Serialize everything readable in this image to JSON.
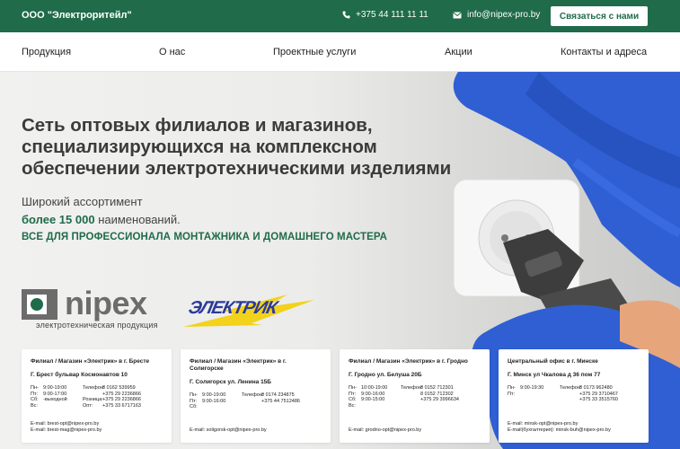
{
  "topbar": {
    "company": "ООО \"Электроритейл\"",
    "phone": "+375 44 111 11 11",
    "email": "info@nipex-pro.by",
    "cta_label": "Связаться с нами"
  },
  "nav": {
    "items": [
      "Продукция",
      "О нас",
      "Проектные услуги",
      "Акции",
      "Контакты и адреса"
    ]
  },
  "hero": {
    "headline_line1": "Сеть оптовых филиалов и магазинов,",
    "headline_line2": "специализирующихся на комплексном",
    "headline_line3": "обеспечении электротехническими изделиями",
    "subtitle1": "Широкий ассортимент",
    "subtitle2_accent": "более 15 000",
    "subtitle2_rest": " наименований.",
    "subtitle3": "ВСЕ ДЛЯ ПРОФЕССИОНАЛА МОНТАЖНИКА И ДОМАШНЕГО МАСТЕРА"
  },
  "logos": {
    "nipex_word": "nipex",
    "nipex_subtitle": "электротехническая продукция",
    "elektrik_word": "ЭЛЕКТРИК"
  },
  "branches": [
    {
      "title": "Филиал / Магазин «Электрик» в г. Бресте",
      "address": "Г. Брест бульвар Космонавтов 10",
      "schedule_labels": [
        "Пн-Пт:",
        "Сб:",
        "Вс:"
      ],
      "schedule_times": [
        "9:00-19:00",
        "9:00-17:00",
        "-выходной"
      ],
      "phone_labels": [
        "Телефон:",
        "",
        "Розница:",
        "Опт:"
      ],
      "phones": [
        "8 0162 539959",
        "+375 29 2236866",
        "+375 29 2236866",
        "+375 33 6717163"
      ],
      "emails": [
        "E-mail: brest-opt@nipex-pro.by",
        "E-mail: brest-mag@nipex-pro.by"
      ]
    },
    {
      "title": "Филиал / Магазин «Электрик» в г. Солигорске",
      "address": "Г. Солигорск ул. Ленина 15Б",
      "schedule_labels": [
        "Пн-Пт:",
        "Сб:"
      ],
      "schedule_times": [
        "9:00-19:00",
        "9:00-16:00"
      ],
      "phone_labels": [
        "Телефон:",
        ""
      ],
      "phones": [
        "8 0174 234875",
        "+375 44 7512486"
      ],
      "emails": [
        "E-mail: soligorsk-opt@nipex-pro.by"
      ]
    },
    {
      "title": "Филиал / Магазин «Электрик» в г. Гродно",
      "address": "Г. Гродно ул. Белуша 20Б",
      "schedule_labels": [
        "Пн-Пт:",
        "Сб:",
        "Вс:"
      ],
      "schedule_times": [
        "10:00-19:00",
        "9:00-16:00",
        "9:00-15:00"
      ],
      "phone_labels": [
        "Телефон:",
        "",
        ""
      ],
      "phones": [
        "8 0152 712301",
        "8 0152 712302",
        "+375 29 3996634"
      ],
      "emails": [
        "E-mail: grodno-opt@nipex-pro.by"
      ]
    },
    {
      "title": "Центральный офис в г. Минске",
      "address": "Г. Минск ул Чкалова д 36 пом 77",
      "schedule_labels": [
        "Пн-Пт:"
      ],
      "schedule_times": [
        "9:00-19:30"
      ],
      "phone_labels": [
        "Телефон:",
        "",
        ""
      ],
      "phones": [
        "8 0173 962480",
        "+375 29 3710467",
        "+375 33 3515760"
      ],
      "emails": [
        "E-mail: minsk-opt@nipex-pro.by",
        "E-mail(бухгалтерия): minsk-buh@nipex-pro.by"
      ]
    }
  ],
  "colors": {
    "brand_green": "#1f6b4a",
    "glove_blue": "#2f5fd3",
    "logo_blue": "#2c3a9a",
    "logo_yellow": "#f2d21a"
  }
}
